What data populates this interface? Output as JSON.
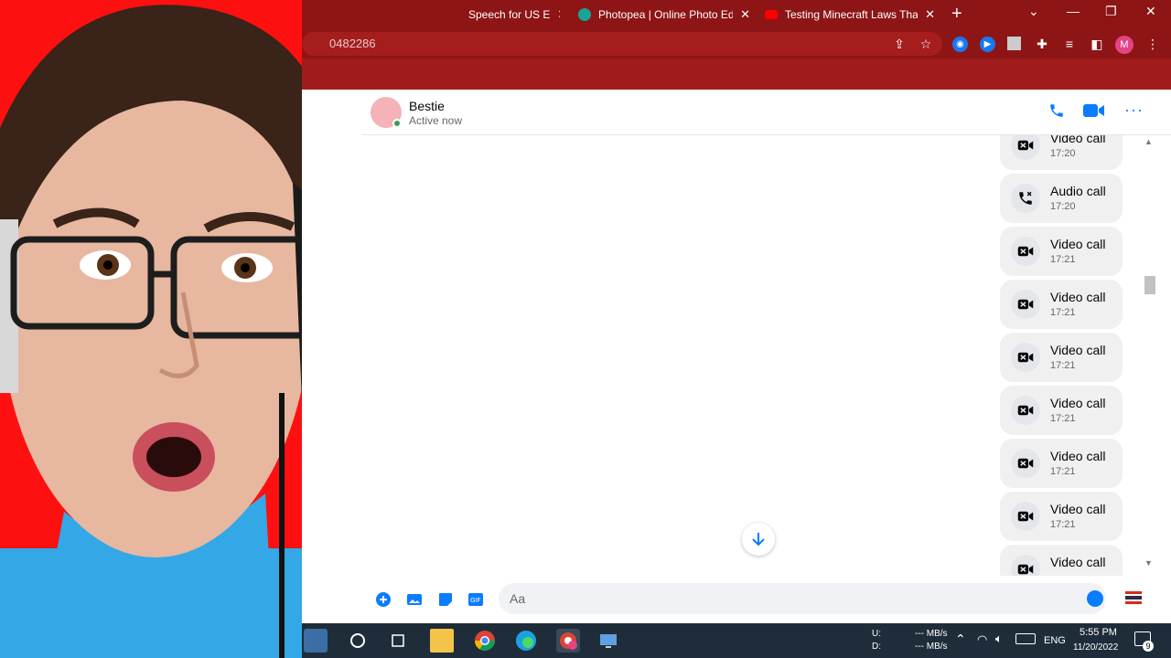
{
  "browser": {
    "tabs": [
      {
        "title": "Speech for US E",
        "icon_color": "#8e1515"
      },
      {
        "title": "Photopea | Online Photo Edi",
        "icon_color": "#18a497"
      },
      {
        "title": "Testing Minecraft Laws That",
        "icon_color": "#ff0000"
      }
    ],
    "tab_close_glyph": "✕",
    "new_tab_glyph": "+",
    "window_controls": {
      "menu": "⌄",
      "minimize": "—",
      "restore": "❐",
      "close": "✕"
    },
    "address": "0482286",
    "profile_initial": "M"
  },
  "chat": {
    "contact_name": "Bestie",
    "contact_status": "Active now",
    "calls": [
      {
        "type": "video",
        "title": "Video call",
        "time": "17:20"
      },
      {
        "type": "audio",
        "title": "Audio call",
        "time": "17:20"
      },
      {
        "type": "video",
        "title": "Video call",
        "time": "17:21"
      },
      {
        "type": "video",
        "title": "Video call",
        "time": "17:21"
      },
      {
        "type": "video",
        "title": "Video call",
        "time": "17:21"
      },
      {
        "type": "video",
        "title": "Video call",
        "time": "17:21"
      },
      {
        "type": "video",
        "title": "Video call",
        "time": "17:21"
      },
      {
        "type": "video",
        "title": "Video call",
        "time": "17:21"
      },
      {
        "type": "video",
        "title": "Video call",
        "time": ""
      }
    ],
    "composer_placeholder": "Aa",
    "accent_color": "#0a7cff"
  },
  "taskbar": {
    "net_up_label": "U:",
    "net_down_label": "D:",
    "net_up": "--- MB/s",
    "net_down": "--- MB/s",
    "language": "ENG",
    "time": "5:55 PM",
    "date": "11/20/2022",
    "notifications": "9"
  }
}
